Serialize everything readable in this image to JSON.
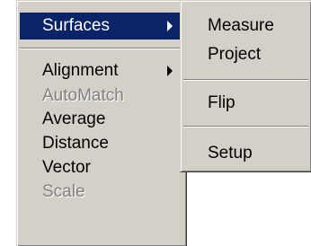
{
  "main_menu": {
    "items": [
      {
        "label": "Surfaces"
      },
      {
        "label": "Alignment"
      },
      {
        "label": "AutoMatch"
      },
      {
        "label": "Average"
      },
      {
        "label": "Distance"
      },
      {
        "label": "Vector"
      },
      {
        "label": "Scale"
      }
    ]
  },
  "sub_menu": {
    "items": [
      {
        "label": "Measure"
      },
      {
        "label": "Project"
      },
      {
        "label": "Flip"
      },
      {
        "label": "Setup"
      }
    ]
  },
  "colors": {
    "menu_bg": "#d4d0c8",
    "highlight": "#0a246a",
    "disabled_text": "#808080"
  },
  "icons": [
    "submenu-arrow-icon"
  ]
}
